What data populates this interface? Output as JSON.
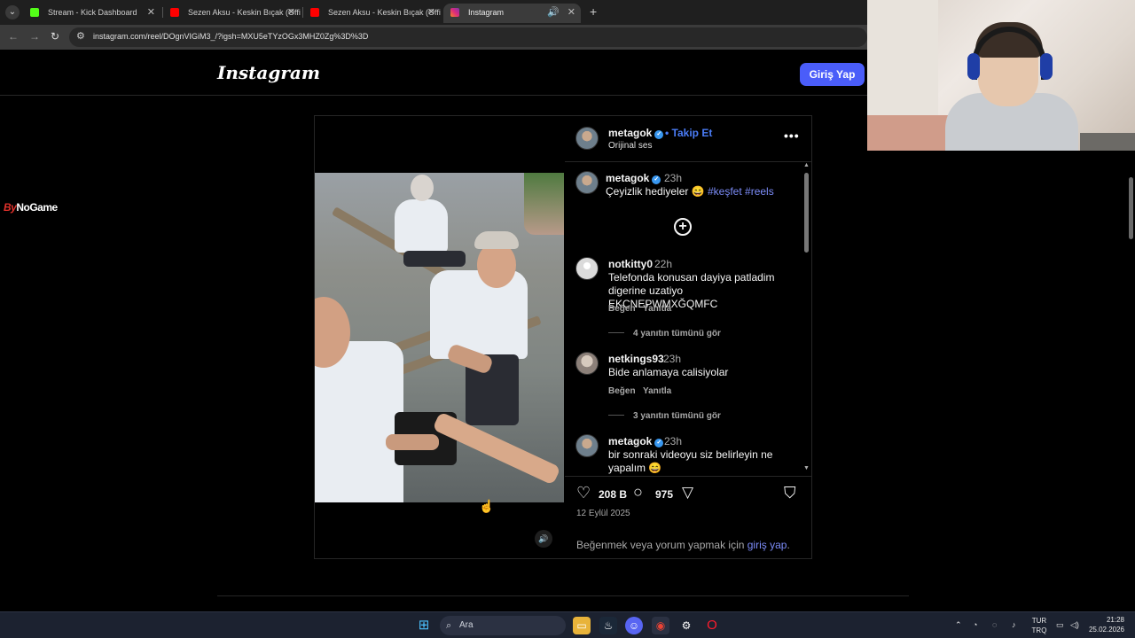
{
  "browser": {
    "tabs": [
      {
        "title": "Stream - Kick Dashboard",
        "favicon_color": "#53fc18"
      },
      {
        "title": "Sezen Aksu - Keskin Bıçak (Offic",
        "favicon_color": "#ff0000"
      },
      {
        "title": "Sezen Aksu - Keskin Bıçak (Offic",
        "favicon_color": "#ff0000"
      },
      {
        "title": "Instagram",
        "favicon_color": "#e1306c",
        "active": true
      }
    ],
    "url": "instagram.com/reel/DOgnVIGiM3_/?igsh=MXU5eTYzOGx3MHZ0Zg%3D%3D"
  },
  "instagram": {
    "logo": "Instagram",
    "login_button": "Giriş Yap",
    "post": {
      "author": "metagok",
      "follow_label": "Takip Et",
      "follow_separator": "•",
      "audio": "Orijinal ses",
      "caption": {
        "author": "metagok",
        "time": "23h",
        "text": "Çeyizlik hediyeler 😄",
        "hashtags": "#keşfet #reels"
      },
      "comments": [
        {
          "user": "notkitty0",
          "time": "22h",
          "text": "Telefonda konusan dayiya patladim digerine uzatiyo EKCNEPWMXĞQMFC",
          "like": "Beğen",
          "reply": "Yanıtla",
          "view_replies": "4 yanıtın tümünü gör"
        },
        {
          "user": "netkings93",
          "time": "23h",
          "text": "Bide anlamaya calisiyolar",
          "like": "Beğen",
          "reply": "Yanıtla",
          "view_replies": "3 yanıtın tümünü gör"
        },
        {
          "user": "metagok",
          "time": "23h",
          "text": "bir sonraki videoyu siz belirleyin ne yapalım 😄"
        }
      ],
      "likes": "208 B",
      "comment_count": "975",
      "date": "12 Eylül 2025",
      "login_prompt_prefix": "Beğenmek veya yorum yapmak için ",
      "login_prompt_link": "giriş yap",
      "login_prompt_suffix": "."
    }
  },
  "overlay": {
    "bynogame_prefix": "By",
    "bynogame_suffix": "NoGame"
  },
  "taskbar": {
    "search_placeholder": "Ara",
    "lang_top": "TUR",
    "lang_bottom": "TRQ",
    "time": "21:28",
    "date": "25.02.2026"
  },
  "colors": {
    "accent": "#4a5df9",
    "link": "#7c8cf8",
    "verified": "#3897f0"
  }
}
